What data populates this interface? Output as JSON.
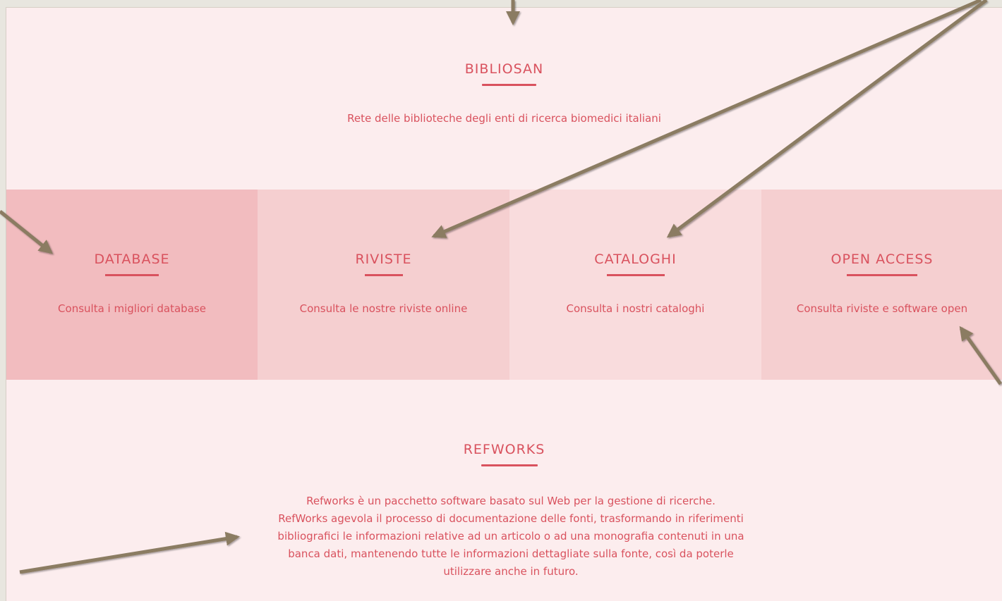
{
  "header": {
    "title": "BIBLIOSAN",
    "subtitle": "Rete delle biblioteche degli enti di ricerca biomedici italiani"
  },
  "tiles": [
    {
      "title": "DATABASE",
      "desc": "Consulta i migliori database",
      "color": "#f2bcbf"
    },
    {
      "title": "RIVISTE",
      "desc": "Consulta le nostre riviste online",
      "color": "#f5cfd0"
    },
    {
      "title": "CATALOGHI",
      "desc": "Consulta i nostri cataloghi",
      "color": "#f9dcdd"
    },
    {
      "title": "OPEN ACCESS",
      "desc": "Consulta riviste e software open",
      "color": "#f5cfd0"
    }
  ],
  "refworks": {
    "title": "REFWORKS",
    "lines": [
      "Refworks è un pacchetto software basato sul Web per la gestione di ricerche.",
      "RefWorks agevola il processo di documentazione delle fonti, trasformando in riferimenti",
      "bibliografici le informazioni relative ad un articolo o ad una monografia contenuti in una",
      "banca dati, mantenendo tutte le informazioni dettagliate sulla fonte, così da poterle",
      "utilizzare anche in futuro."
    ]
  },
  "colors": {
    "accent": "#d9525e",
    "page_bg": "#fcedee",
    "arrow": "#8b7b62"
  }
}
